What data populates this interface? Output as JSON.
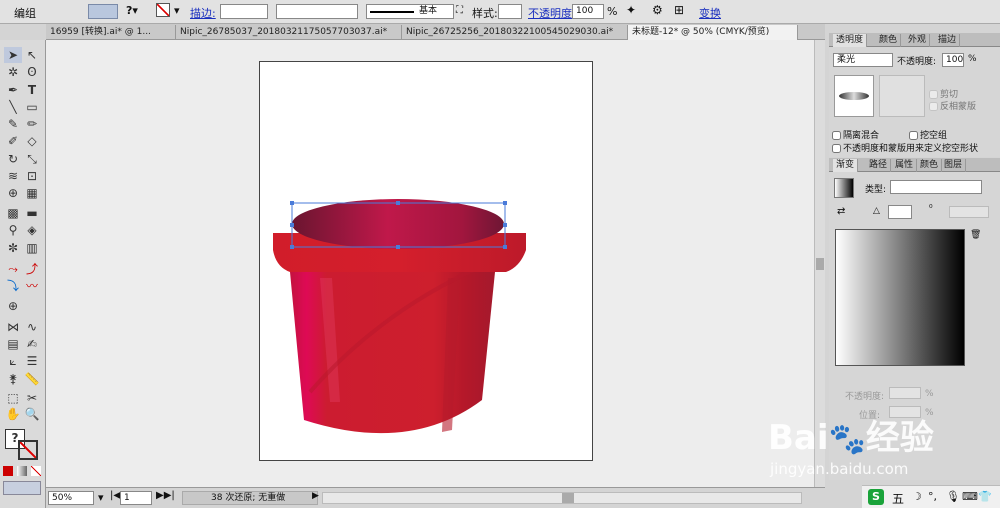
{
  "control_bar": {
    "mode": "编组",
    "stroke_label": "描边:",
    "stroke_style": "基本",
    "style_label": "样式:",
    "opacity_label": "不透明度:",
    "opacity_value": "100",
    "opacity_unit": "%",
    "transform": "变换"
  },
  "doc_tabs": [
    {
      "title": "16959 [转换].ai* @ 1...",
      "active": false
    },
    {
      "title": "Nipic_26785037_20180321175057703037.ai*",
      "active": false
    },
    {
      "title": "Nipic_26725256_20180322100545029030.ai*",
      "active": false
    },
    {
      "title": "未标题-12* @ 50% (CMYK/预览)",
      "active": true
    }
  ],
  "status_bar": {
    "zoom": "50%",
    "page": "1",
    "undo": "38 次还原; 无重做"
  },
  "transparency_panel": {
    "tabs": [
      "透明度",
      "颜色",
      "外观",
      "描边"
    ],
    "blend_mode": "柔光",
    "opacity_label": "不透明度:",
    "opacity_value": "100",
    "opacity_unit": "%",
    "clip": "剪切",
    "invert_mask": "反相蒙版",
    "isolate_blending": "隔离混合",
    "knockout_group": "挖空组",
    "opacity_mask_knockout": "不透明度和蒙版用来定义挖空形状"
  },
  "gradient_panel": {
    "tabs": [
      "渐变",
      "路径",
      "属性",
      "颜色",
      "图层"
    ],
    "type_label": "类型:",
    "opacity_label": "不透明度:",
    "location_label": "位置:",
    "pct": "%"
  },
  "watermark": {
    "brand": "Bai",
    "brand2": "经验",
    "url": "jingyan.baidu.com"
  },
  "taskbar": {
    "ime": "五"
  },
  "colors": {
    "bucket": "#d42230",
    "rim_dark": "#6a1530",
    "rim_light": "#c0184a"
  }
}
